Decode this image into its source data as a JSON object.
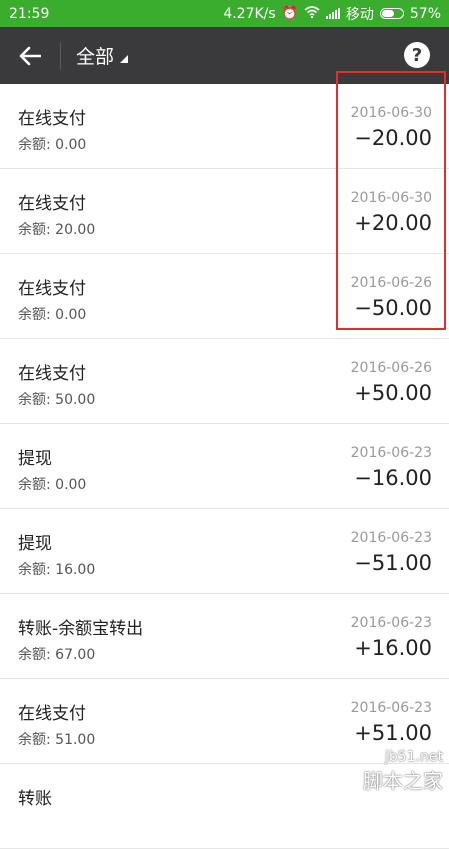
{
  "status_bar": {
    "time": "21:59",
    "speed": "4.27K/s",
    "carrier": "移动",
    "battery": "57%",
    "icons": [
      "alarm-icon",
      "wifi-icon",
      "signal-icon",
      "battery-icon"
    ]
  },
  "toolbar": {
    "filter_label": "全部",
    "help_label": "?"
  },
  "transactions": [
    {
      "title": "在线支付",
      "balance": "余额: 0.00",
      "date": "2016-06-30",
      "amount": "−20.00"
    },
    {
      "title": "在线支付",
      "balance": "余额: 20.00",
      "date": "2016-06-30",
      "amount": "+20.00"
    },
    {
      "title": "在线支付",
      "balance": "余额: 0.00",
      "date": "2016-06-26",
      "amount": "−50.00"
    },
    {
      "title": "在线支付",
      "balance": "余额: 50.00",
      "date": "2016-06-26",
      "amount": "+50.00"
    },
    {
      "title": "提现",
      "balance": "余额: 0.00",
      "date": "2016-06-23",
      "amount": "−16.00"
    },
    {
      "title": "提现",
      "balance": "余额: 16.00",
      "date": "2016-06-23",
      "amount": "−51.00"
    },
    {
      "title": "转账-余额宝转出",
      "balance": "余额: 67.00",
      "date": "2016-06-23",
      "amount": "+16.00"
    },
    {
      "title": "在线支付",
      "balance": "余额: 51.00",
      "date": "2016-06-23",
      "amount": "+51.00"
    },
    {
      "title": "转账",
      "balance": "",
      "date": "",
      "amount": ""
    }
  ],
  "watermark": {
    "url": "jb51.net",
    "name": "脚本之家"
  },
  "colors": {
    "status_bar": "#3aad2e",
    "toolbar": "#3a3a3c",
    "highlight": "#e0302c"
  }
}
